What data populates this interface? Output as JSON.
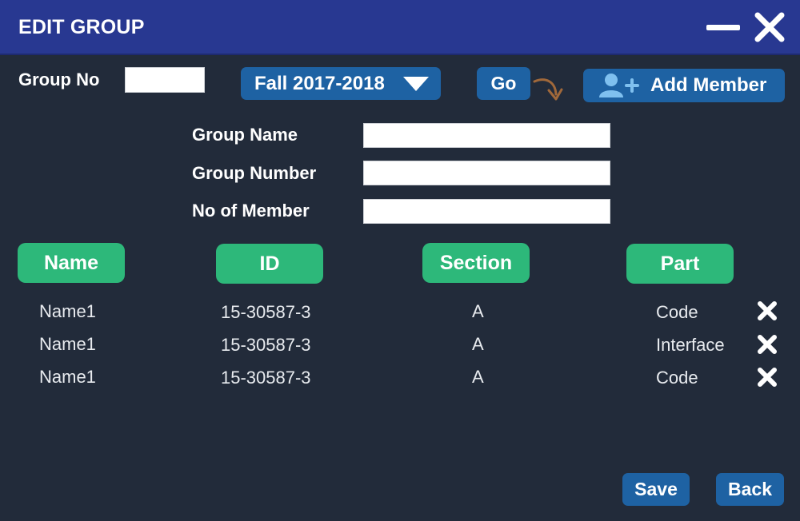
{
  "window": {
    "title": "EDIT GROUP",
    "minimize_icon": "minimize-icon",
    "close_icon": "close-icon"
  },
  "toolbar": {
    "group_no_label": "Group No",
    "group_no_value": "",
    "semester_selected": "Fall 2017-2018",
    "go_label": "Go",
    "add_member_label": "Add Member",
    "add_member_icon": "add-user-icon",
    "arrow_icon": "curved-arrow-icon"
  },
  "form": {
    "group_name_label": "Group Name",
    "group_name_value": "",
    "group_number_label": "Group Number",
    "group_number_value": "",
    "no_of_member_label": "No of Member",
    "no_of_member_value": ""
  },
  "table": {
    "headers": [
      "Name",
      "ID",
      "Section",
      "Part"
    ],
    "rows": [
      {
        "name": "Name1",
        "id": "15-30587-3",
        "section": "A",
        "part": "Code"
      },
      {
        "name": "Name1",
        "id": "15-30587-3",
        "section": "A",
        "part": "Interface"
      },
      {
        "name": "Name1",
        "id": "15-30587-3",
        "section": "A",
        "part": "Code"
      }
    ],
    "remove_icon": "remove-icon"
  },
  "footer": {
    "save_label": "Save",
    "back_label": "Back"
  },
  "colors": {
    "background": "#222b3a",
    "titlebar": "#283891",
    "button_blue": "#1e62a3",
    "header_green": "#2db87a",
    "arrow_brown": "#a0683a"
  }
}
